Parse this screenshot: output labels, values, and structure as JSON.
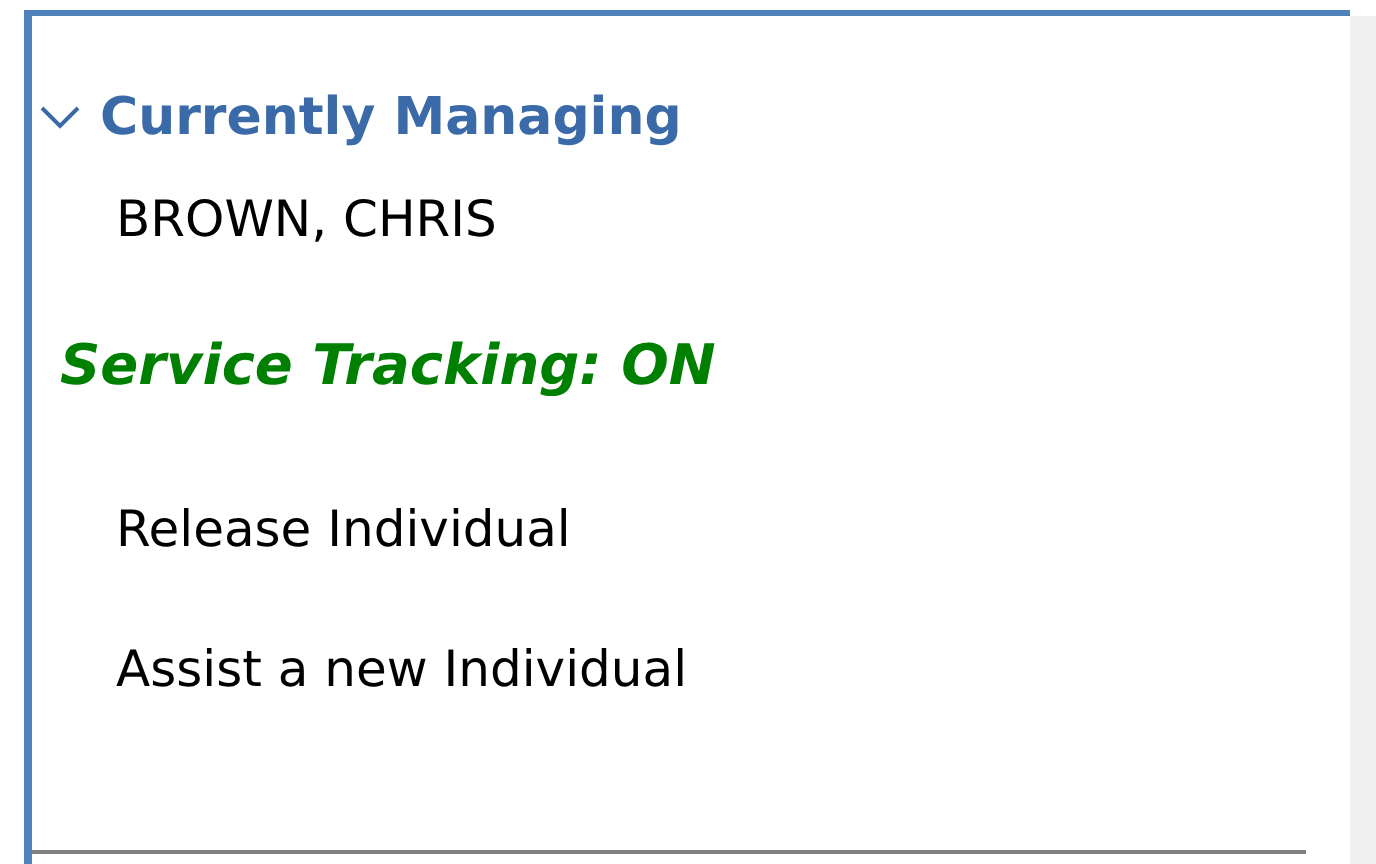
{
  "section": {
    "title": "Currently Managing",
    "expanded": true,
    "person": "BROWN, CHRIS"
  },
  "service_tracking": {
    "label": "Service Tracking: ON",
    "on": true
  },
  "actions": [
    {
      "label": "Release Individual"
    },
    {
      "label": "Assist a new Individual"
    }
  ]
}
